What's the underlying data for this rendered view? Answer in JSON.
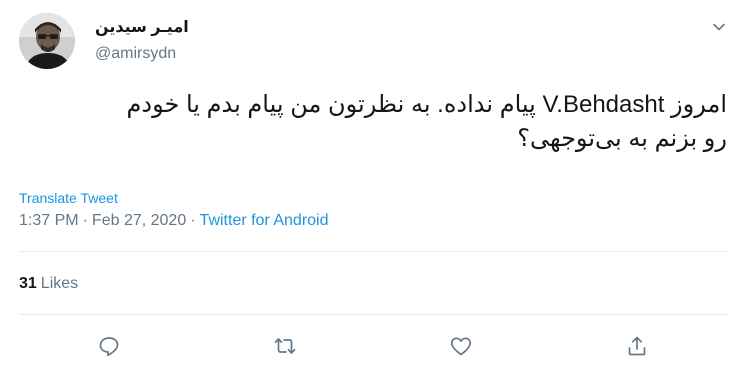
{
  "user": {
    "display_name": "امیـر سیدین",
    "handle": "@amirsydn"
  },
  "tweet": {
    "text_lines": [
      "امروز V.Behdasht پیام نداده. به نظرتون من پیام بدم یا خودم",
      "رو بزنم به بی‌توجهی؟"
    ],
    "translate_label": "Translate Tweet",
    "time": "1:37 PM",
    "date": "Feb 27, 2020",
    "separator": "·",
    "source": "Twitter for Android"
  },
  "stats": {
    "likes_count": "31",
    "likes_label": "Likes"
  },
  "actions": {
    "icons": [
      "reply-icon",
      "retweet-icon",
      "like-icon",
      "share-icon"
    ]
  },
  "colors": {
    "text": "#14171a",
    "secondary": "#657786",
    "accent": "#1b95e0",
    "border": "#e6ecf0"
  }
}
